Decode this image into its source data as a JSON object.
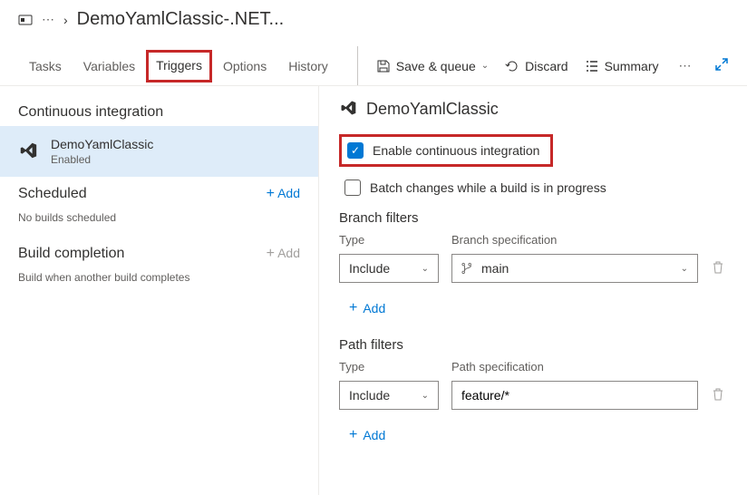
{
  "breadcrumb": {
    "separator": "›",
    "title": "DemoYamlClassic-.NET..."
  },
  "tabs": {
    "tasks": "Tasks",
    "variables": "Variables",
    "triggers": "Triggers",
    "options": "Options",
    "history": "History"
  },
  "toolbar": {
    "save_queue": "Save & queue",
    "discard": "Discard",
    "summary": "Summary"
  },
  "sidebar": {
    "ci_title": "Continuous integration",
    "ci_item": {
      "name": "DemoYamlClassic",
      "status": "Enabled"
    },
    "scheduled_title": "Scheduled",
    "scheduled_add": "Add",
    "scheduled_empty": "No builds scheduled",
    "build_completion_title": "Build completion",
    "build_completion_add": "Add",
    "build_completion_empty": "Build when another build completes"
  },
  "content": {
    "title": "DemoYamlClassic",
    "enable_ci": "Enable continuous integration",
    "batch_changes": "Batch changes while a build is in progress",
    "branch_filters": {
      "title": "Branch filters",
      "type_label": "Type",
      "spec_label": "Branch specification",
      "type_value": "Include",
      "spec_value": "main",
      "add": "Add"
    },
    "path_filters": {
      "title": "Path filters",
      "type_label": "Type",
      "spec_label": "Path specification",
      "type_value": "Include",
      "spec_value": "feature/*",
      "add": "Add"
    }
  }
}
